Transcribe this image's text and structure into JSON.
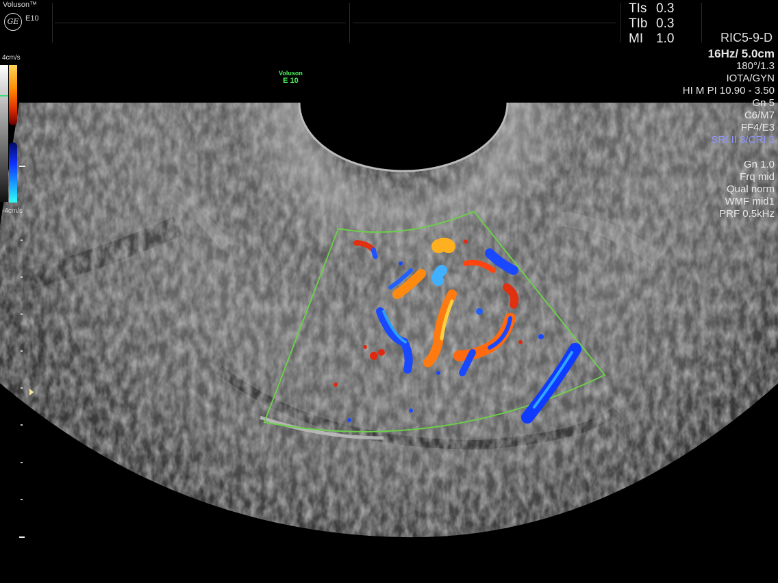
{
  "header": {
    "brand": "Voluson™",
    "model": "E10",
    "logo": "GE",
    "safety": [
      {
        "label": "TIs",
        "value": "0.3"
      },
      {
        "label": "TIb",
        "value": "0.3"
      },
      {
        "label": "MI",
        "value": "1.0"
      }
    ],
    "probe": "RIC5-9-D"
  },
  "params": {
    "frame_depth": "16Hz/ 5.0cm",
    "angle": "180°/1.3",
    "preset": "IOTA/GYN",
    "harmonics": "HI M PI 10.90 - 3.50",
    "gain": "Gn   5",
    "map": "C6/M7",
    "filter": "FF4/E3",
    "sri": "SRI II 3/CRI 3"
  },
  "color_params": {
    "gain": "Gn  1.0",
    "frequency": "Frq mid",
    "quality": "Qual norm",
    "wall_filter": "WMF mid1",
    "prf": "PRF  0.5kHz"
  },
  "color_scale": {
    "top": "4cm/s",
    "bottom": "-4cm/s"
  },
  "image_label": {
    "line1": "Voluson",
    "line2": "E 10"
  },
  "colors": {
    "roi_box": "#6ccf4a",
    "flow_red": "#e03010",
    "flow_blue": "#1040ff",
    "sri_text": "#8f97ff",
    "label_green": "#4cf55a"
  },
  "icons": [
    "ge-logo-icon",
    "focus-marker-icon"
  ]
}
